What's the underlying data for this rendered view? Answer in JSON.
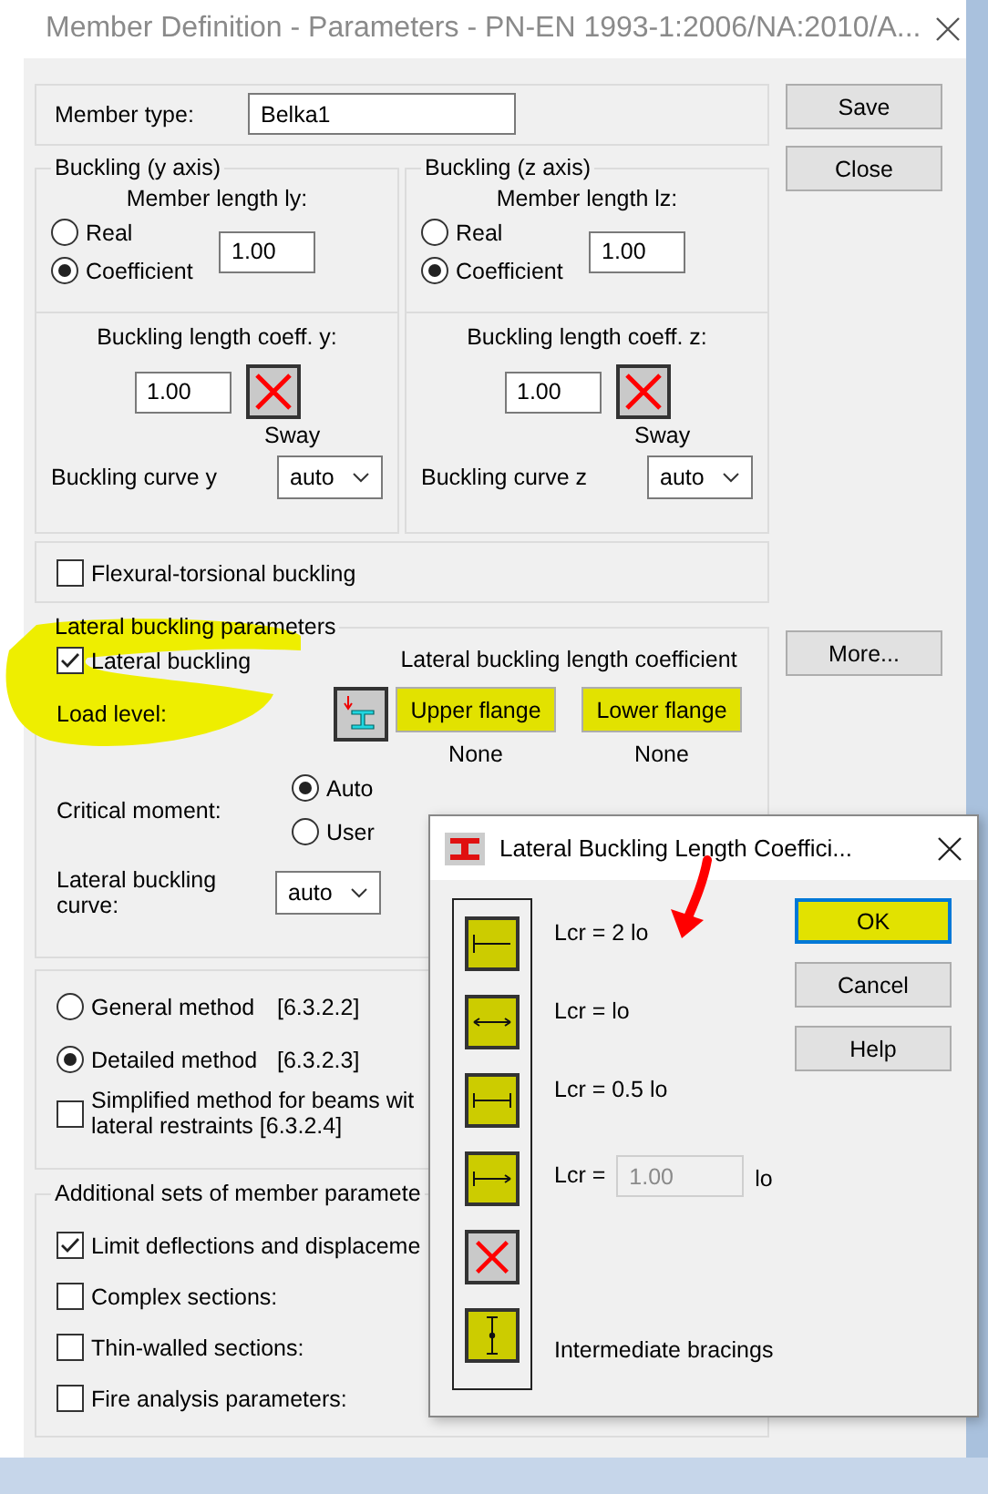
{
  "window": {
    "title": "Member Definition - Parameters - PN-EN 1993-1:2006/NA:2010/A..."
  },
  "member_type": {
    "label": "Member type:",
    "value": "Belka1"
  },
  "buckling": [
    {
      "title": "Buckling (y axis)",
      "length_label": "Member length ly:",
      "options": [
        {
          "label": "Real",
          "selected": false
        },
        {
          "label": "Coefficient",
          "selected": true
        }
      ],
      "length_value": "1.00",
      "coeff_label": "Buckling length coeff. y:",
      "coeff_value": "1.00",
      "sway_label": "Sway",
      "curve_label": "Buckling curve y",
      "curve_value": "auto"
    },
    {
      "title": "Buckling (z axis)",
      "length_label": "Member length lz:",
      "options": [
        {
          "label": "Real",
          "selected": false
        },
        {
          "label": "Coefficient",
          "selected": true
        }
      ],
      "length_value": "1.00",
      "coeff_label": "Buckling length coeff. z:",
      "coeff_value": "1.00",
      "sway_label": "Sway",
      "curve_label": "Buckling curve z",
      "curve_value": "auto"
    }
  ],
  "flexural_torsional": {
    "label": "Flexural-torsional buckling",
    "checked": false
  },
  "lateral": {
    "title": "Lateral buckling parameters",
    "circled": true,
    "lateral_buckling": {
      "label": "Lateral buckling",
      "checked": true
    },
    "length_coeff_title": "Lateral buckling length coefficient",
    "load_level_label": "Load level:",
    "flanges": [
      {
        "label": "Upper flange",
        "value": "None",
        "highlighted": true
      },
      {
        "label": "Lower flange",
        "value": "None",
        "highlighted": true
      }
    ],
    "critical_moment_label": "Critical moment:",
    "critical_moment_options": [
      {
        "label": "Auto",
        "selected": true
      },
      {
        "label": "User",
        "selected": false
      }
    ],
    "curve_label": "Lateral buckling curve:",
    "curve_value": "auto"
  },
  "methods": [
    {
      "label": "General method",
      "ref": "[6.3.2.2]",
      "selected": false
    },
    {
      "label": "Detailed method",
      "ref": "[6.3.2.3]",
      "selected": true
    }
  ],
  "simplified": {
    "lines": [
      "Simplified method for beams wit",
      "lateral restraints [6.3.2.4]"
    ],
    "checked": false
  },
  "additional": {
    "title": "Additional sets of member paramete",
    "items": [
      {
        "label": "Limit deflections and displaceme",
        "checked": true
      },
      {
        "label": "Complex sections:",
        "checked": false
      },
      {
        "label": "Thin-walled sections:",
        "checked": false
      },
      {
        "label": "Fire analysis parameters:",
        "checked": false
      }
    ]
  },
  "side_buttons": [
    {
      "label": "Save"
    },
    {
      "label": "Close"
    },
    {
      "label": "More..."
    }
  ],
  "popup": {
    "title": "Lateral Buckling Length Coeffici...",
    "options": [
      {
        "kind": "fixed-left",
        "label": "Lcr = 2 lo",
        "highlighted": true,
        "arrow": true
      },
      {
        "kind": "pinned",
        "label": "Lcr = lo",
        "highlighted": true
      },
      {
        "kind": "fixed",
        "label": "Lcr = 0.5 lo",
        "highlighted": true
      },
      {
        "kind": "custom",
        "label": "Lcr =",
        "value": "1.00",
        "disabled": true,
        "unit": "lo",
        "highlighted": true
      },
      {
        "kind": "none",
        "highlighted": false
      },
      {
        "kind": "bracing",
        "label": "Intermediate bracings",
        "highlighted": true
      }
    ],
    "buttons": [
      {
        "label": "OK",
        "default": true,
        "highlighted": true
      },
      {
        "label": "Cancel",
        "default": false,
        "highlighted": false
      },
      {
        "label": "Help",
        "default": false,
        "highlighted": false
      }
    ]
  }
}
